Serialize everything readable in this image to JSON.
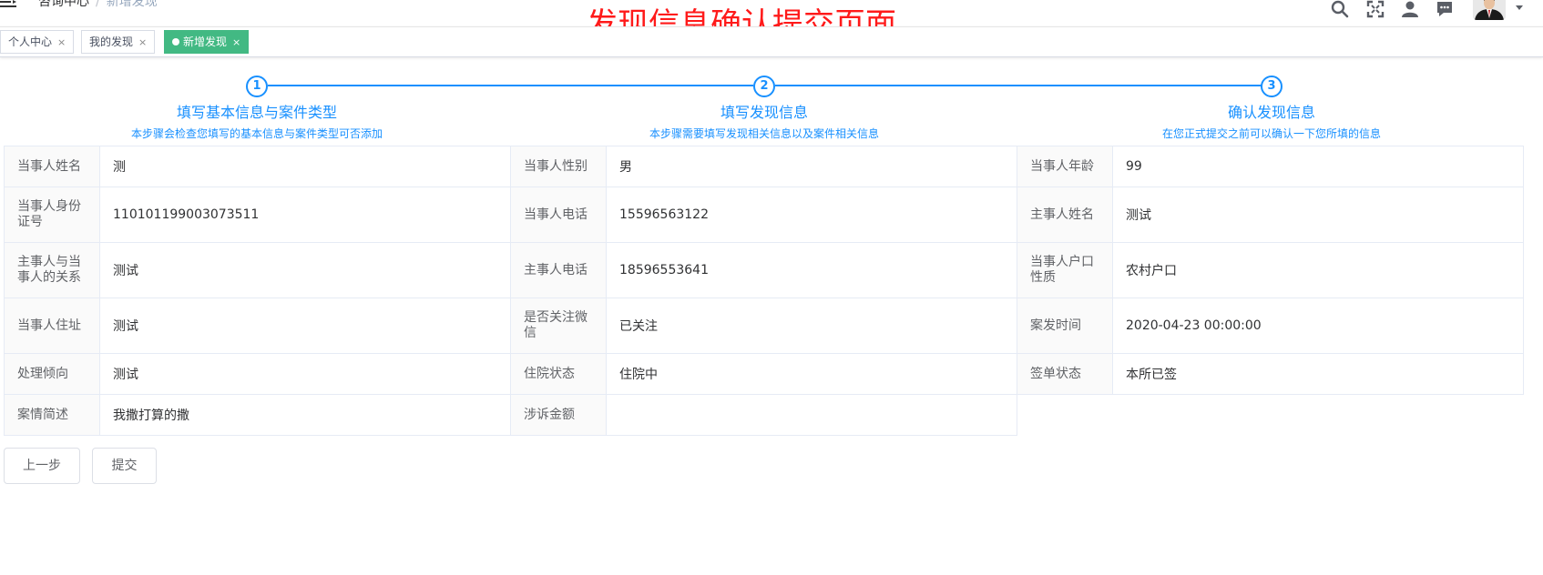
{
  "header": {
    "breadcrumb": [
      "咨询中心",
      "新增发现"
    ],
    "breadcrumb_separator": "/",
    "icons": [
      "search-icon",
      "fullscreen-icon",
      "user-icon",
      "message-icon"
    ]
  },
  "overlay_title": "发现信息确认提交页面",
  "tabs": [
    {
      "label": "个人中心",
      "close": "×",
      "active": false
    },
    {
      "label": "我的发现",
      "close": "×",
      "active": false
    },
    {
      "label": "新增发现",
      "close": "×",
      "active": true
    }
  ],
  "steps": [
    {
      "number": "1",
      "title": "填写基本信息与案件类型",
      "description": "本步骤会检查您填写的基本信息与案件类型可否添加"
    },
    {
      "number": "2",
      "title": "填写发现信息",
      "description": "本步骤需要填写发现相关信息以及案件相关信息"
    },
    {
      "number": "3",
      "title": "确认发现信息",
      "description": "在您正式提交之前可以确认一下您所填的信息"
    }
  ],
  "details": {
    "rows": [
      [
        {
          "label": "当事人姓名",
          "value": "测"
        },
        {
          "label": "当事人性别",
          "value": "男"
        },
        {
          "label": "当事人年龄",
          "value": "99"
        }
      ],
      [
        {
          "label": "当事人身份证号",
          "value": "110101199003073511"
        },
        {
          "label": "当事人电话",
          "value": "15596563122"
        },
        {
          "label": "主事人姓名",
          "value": "测试"
        }
      ],
      [
        {
          "label": "主事人与当事人的关系",
          "value": "测试"
        },
        {
          "label": "主事人电话",
          "value": "18596553641"
        },
        {
          "label": "当事人户口性质",
          "value": "农村户口"
        }
      ],
      [
        {
          "label": "当事人住址",
          "value": "测试"
        },
        {
          "label": "是否关注微信",
          "value": "已关注"
        },
        {
          "label": "案发时间",
          "value": "2020-04-23 00:00:00"
        }
      ],
      [
        {
          "label": "处理倾向",
          "value": "测试"
        },
        {
          "label": "住院状态",
          "value": "住院中"
        },
        {
          "label": "签单状态",
          "value": "本所已签"
        }
      ],
      [
        {
          "label": "案情简述",
          "value": "我撒打算的撒"
        },
        {
          "label": "涉诉金额",
          "value": ""
        }
      ]
    ]
  },
  "buttons": {
    "prev": "上一步",
    "submit": "提交"
  },
  "colors": {
    "primary": "#1890ff",
    "tag_active": "#42b983",
    "overlay_title": "#ff1a1a"
  }
}
